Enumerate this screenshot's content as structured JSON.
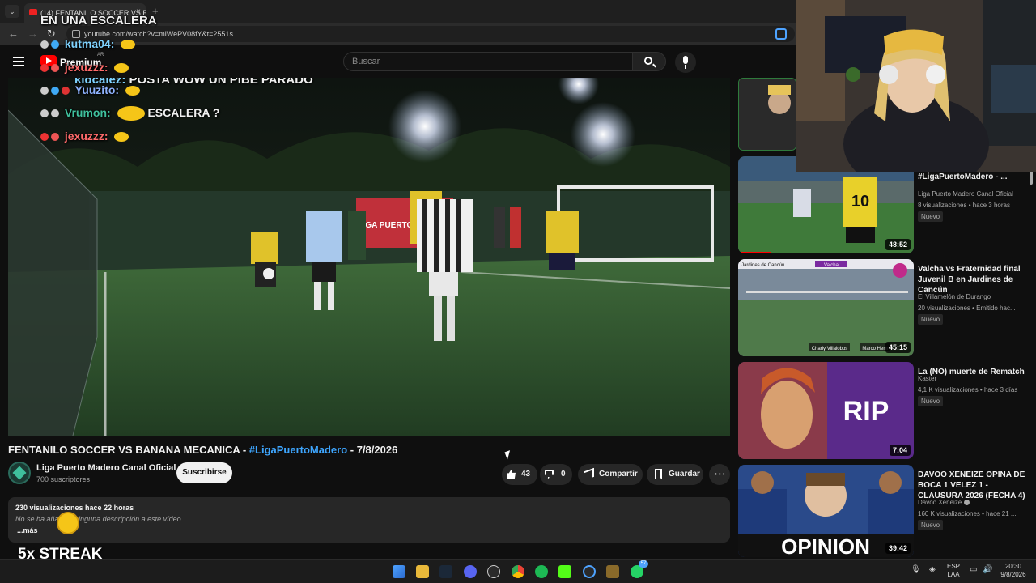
{
  "browser": {
    "tab_title": "(14) FENTANILO SOCCER VS BANANA MECANICA",
    "tab_close": "×",
    "new_tab": "+",
    "url": "youtube.com/watch?v=miWePV08fY&t=2551s"
  },
  "youtube": {
    "brand": "Premium",
    "country": "AR",
    "search_placeholder": "Buscar"
  },
  "chat": {
    "top_message": "POSTA WOW UN PIBE PARADO",
    "top_user": "kidcaiez:",
    "line2": "EN UNA ESCALERA",
    "messages": [
      {
        "user": "kutma04:",
        "text": "",
        "color": "#7fd3ff"
      },
      {
        "user": "jexuzzz:",
        "text": "",
        "color": "#ff6b6b"
      },
      {
        "user": "Yuuzito:",
        "text": "",
        "color": "#8fb3ff"
      },
      {
        "user": "Vrumon:",
        "text": "ESCALERA ?",
        "color": "#3fbf9c"
      },
      {
        "user": "jexuzzz:",
        "text": "",
        "color": "#ff6b6b"
      }
    ]
  },
  "video": {
    "title_prefix": "FENTANILO SOCCER VS BANANA MECANICA - ",
    "title_tag": "#LigaPuertoMadero",
    "title_suffix": " - 7/8/2026",
    "channel_name": "Liga Puerto Madero Canal Oficial",
    "subscribers": "700 suscriptores",
    "subscribe_label": "Suscribirse",
    "likes": "43",
    "dislikes": "0",
    "share_label": "Compartir",
    "save_label": "Guardar",
    "views_time": "230 visualizaciones  hace 22 horas",
    "description": "No se ha añadido ninguna descripción a este vídeo.",
    "more_label": "...más",
    "banner_text": "LIGA PUERTO MADERO"
  },
  "overlay": {
    "streak": "5x STREAK"
  },
  "recommendations": [
    {
      "title": "BEAVER - #LigaPuertoMadero - ...",
      "channel": "Liga Puerto Madero Canal Oficial",
      "stats": "8 visualizaciones • hace 3 horas",
      "badge": "Nuevo",
      "duration": "48:52",
      "verified": false,
      "jersey_number": "10"
    },
    {
      "title": "Valcha vs Fraternidad final Juvenil B en Jardines de Cancún",
      "channel": "El Villamelón de Durango",
      "stats": "20 visualizaciones • Emitido hac...",
      "badge": "Nuevo",
      "duration": "45:15",
      "verified": false,
      "scoreboard": "Jardines de Cancún",
      "team2": "Valcha",
      "player1": "Charly Villalobos",
      "player2": "Marco Hern"
    },
    {
      "title": "La (NO) muerte de Rematch",
      "channel": "Kaster",
      "stats": "4,1 K visualizaciones • hace 3 días",
      "badge": "Nuevo",
      "duration": "7:04",
      "verified": false,
      "thumb_text": "RIP"
    },
    {
      "title": "DAVOO XENEIZE OPINA DE BOCA 1 VELEZ 1 - CLAUSURA 2026 (FECHA 4)",
      "channel": "Davoo Xeneize",
      "stats": "160 K visualizaciones • hace 21 ...",
      "badge": "Nuevo",
      "duration": "39:42",
      "verified": true,
      "thumb_text": "OPINION"
    }
  ],
  "taskbar": {
    "lang_top": "ESP",
    "lang_bottom": "LAA",
    "time": "20:30",
    "date": "9/8/2026",
    "whatsapp_badge": "57"
  },
  "colors": {
    "accent": "#3ea6ff",
    "yt_red": "#ff0000",
    "background": "#0f0f0f"
  }
}
